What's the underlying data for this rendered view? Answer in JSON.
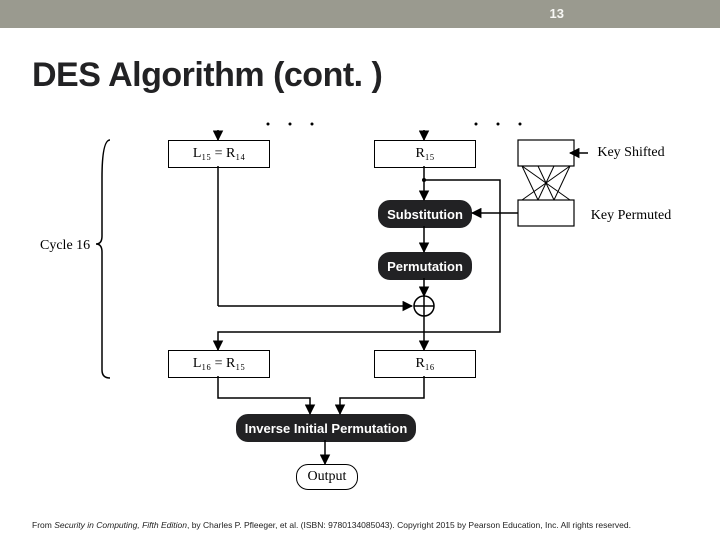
{
  "header": {
    "page_number": "13"
  },
  "title": "DES Algorithm (cont. )",
  "diagram": {
    "cycle_label": "Cycle 16",
    "l15_box": "L₁₅ = R₁₄",
    "r15_box": "R₁₅",
    "key_shifted": "Key Shifted",
    "key_permuted": "Key Permuted",
    "substitution": "Substitution",
    "permutation": "Permutation",
    "l16_box": "L₁₆ = R₁₅",
    "r16_box": "R₁₆",
    "inverse_perm": "Inverse Initial Permutation",
    "output": "Output"
  },
  "footer": {
    "prefix": "From ",
    "book": "Security in Computing, Fifth Edition",
    "rest": ", by Charles P. Pfleeger, et al. (ISBN: 9780134085043). Copyright 2015 by Pearson Education, Inc. All rights reserved."
  }
}
